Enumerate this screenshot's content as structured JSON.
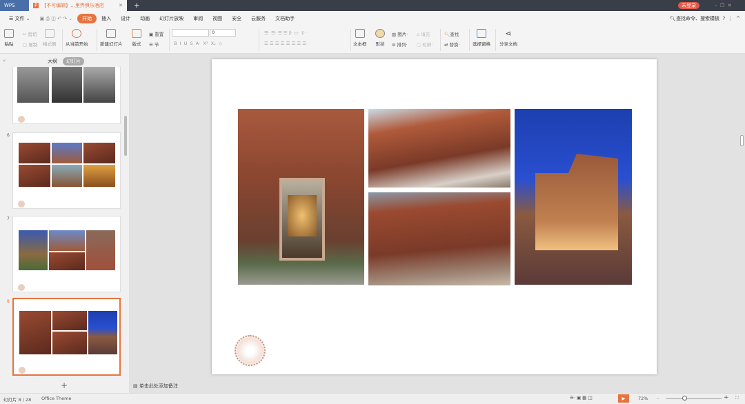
{
  "titlebar": {
    "app": "WPS",
    "doc_tab": "【不可编辑】...里弄俱乐酒店",
    "login": "未登录"
  },
  "menu": {
    "file": "文件",
    "items": [
      "开始",
      "插入",
      "设计",
      "动画",
      "幻灯片放映",
      "审阅",
      "视图",
      "安全",
      "云服务",
      "文档助手"
    ],
    "search": "查找命令、搜索模板"
  },
  "ribbon": {
    "paste": "粘贴",
    "cut": "剪切",
    "copy": "复制",
    "format_painter": "格式刷",
    "play_from_current": "从当前开始",
    "new_slide": "新建幻灯片",
    "layout": "版式",
    "reset": "重置",
    "section": "节",
    "font_size": "0",
    "textbox": "文本框",
    "shape": "形状",
    "picture": "图片",
    "fill": "填充",
    "arrange": "排列",
    "outline": "轮廓",
    "find": "查找",
    "replace": "替换",
    "select_pane": "选择窗格",
    "share": "分享文档"
  },
  "panel": {
    "tab_outline": "大纲",
    "tab_slides": "幻灯片",
    "slide_numbers": [
      "6",
      "7",
      "8"
    ]
  },
  "notes": {
    "placeholder": "单击此处添加备注"
  },
  "status": {
    "slide_info": "幻灯片 8 / 28",
    "theme": "Office Theme",
    "zoom": "72%"
  },
  "colors": {
    "accent": "#e8733c",
    "titlebar": "#3a3e49"
  }
}
